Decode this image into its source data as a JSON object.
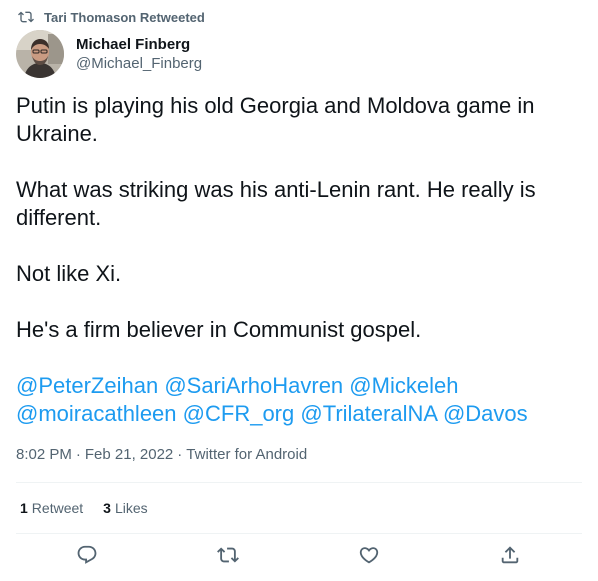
{
  "retweet": {
    "icon": "retweet-icon",
    "text": "Tari Thomason Retweeted"
  },
  "author": {
    "display_name": "Michael Finberg",
    "handle": "@Michael_Finberg",
    "avatar_icon": "avatar-photo"
  },
  "tweet": {
    "paragraphs": [
      "Putin is playing his old Georgia and Moldova game in Ukraine.",
      "What was striking was his anti-Lenin rant. He really is different.",
      "Not like Xi.",
      "He's a firm believer in Communist gospel."
    ],
    "mentions": [
      "@PeterZeihan",
      "@SariArhoHavren",
      "@Mickeleh",
      "@moiracathleen",
      "@CFR_org",
      "@TrilateralNA",
      "@Davos"
    ]
  },
  "meta": {
    "time": "8:02 PM",
    "separator": "·",
    "date": "Feb 21, 2022",
    "source": "Twitter for Android"
  },
  "stats": {
    "retweets_count": "1",
    "retweets_label": "Retweet",
    "likes_count": "3",
    "likes_label": "Likes"
  },
  "actions": {
    "reply_icon": "reply-icon",
    "retweet_icon": "retweet-icon",
    "like_icon": "heart-icon",
    "share_icon": "share-icon"
  },
  "colors": {
    "text": "#0f1419",
    "secondary": "#536471",
    "link": "#1d9bf0",
    "divider": "#eff3f4"
  }
}
